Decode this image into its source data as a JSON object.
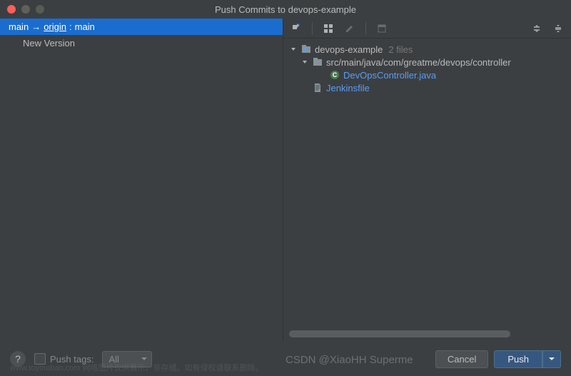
{
  "title": "Push Commits to devops-example",
  "leftPanel": {
    "branchLocal": "main",
    "arrow": "→",
    "remote": "origin",
    "colon": ":",
    "branchRemote": "main",
    "commits": [
      "New Version"
    ]
  },
  "tree": {
    "root": {
      "name": "devops-example",
      "fileCount": "2 files"
    },
    "folder": "src/main/java/com/greatme/devops/controller",
    "modifiedFile": "DevOpsController.java",
    "file": "Jenkinsfile"
  },
  "footer": {
    "pushTagsLabel": "Push tags:",
    "selectValue": "All",
    "cancelLabel": "Cancel",
    "pushLabel": "Push"
  },
  "watermark": "CSDN @XiaoHH Superme",
  "watermark2": "www.toymoban.com 网络图片仅供展示，非存储。如有侵权请联系删除。"
}
